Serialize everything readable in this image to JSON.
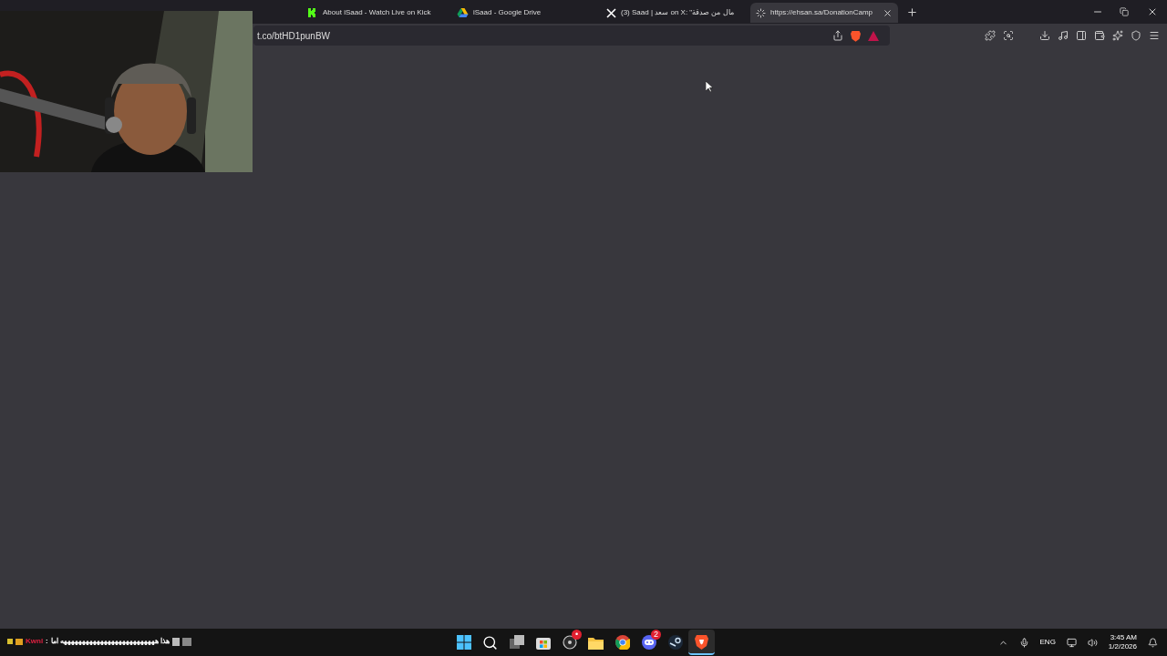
{
  "tabs": [
    {
      "title": "About iSaad - Watch Live on Kick",
      "kind": "kick",
      "selected": false,
      "loading": false
    },
    {
      "title": "iSaad - Google Drive",
      "kind": "drive",
      "selected": false,
      "loading": false
    },
    {
      "title": "(3) Saad | سعد on X: \"مال من صدقة",
      "kind": "x",
      "selected": false,
      "loading": false
    },
    {
      "title": "https://ehsan.sa/DonationCamp",
      "selected": true,
      "loading": true
    }
  ],
  "address_bar": {
    "url": "t.co/btHD1punBW"
  },
  "chat_overlay": {
    "user": "Kwnl",
    "separator": ":",
    "message": "هذا ههههههههههههههههههههههههههه اما"
  },
  "taskbar": {
    "apps": [
      {
        "kind": "start",
        "active": false
      },
      {
        "kind": "search",
        "active": false
      },
      {
        "kind": "taskview",
        "active": false
      },
      {
        "kind": "store",
        "active": false
      },
      {
        "kind": "obs",
        "active": false,
        "badge": "•"
      },
      {
        "kind": "folder",
        "active": false
      },
      {
        "kind": "chrome",
        "active": false
      },
      {
        "kind": "discord",
        "active": false,
        "badge": "2"
      },
      {
        "kind": "steam",
        "active": false
      },
      {
        "kind": "brave",
        "active": true
      }
    ],
    "tray": {
      "language": "ENG",
      "time": "3:45 AM",
      "date": "1/2/2026"
    }
  }
}
